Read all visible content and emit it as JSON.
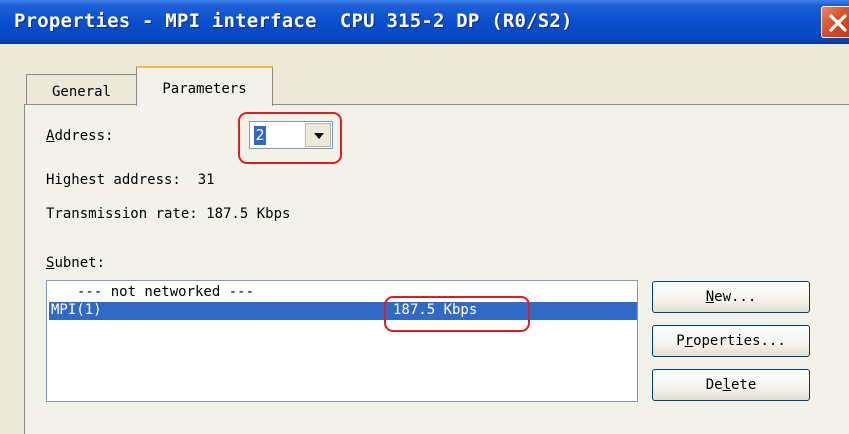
{
  "window": {
    "title": "Properties - MPI interface  CPU 315-2 DP (R0/S2)",
    "close_icon": "close-icon"
  },
  "tabs": [
    {
      "label": "General",
      "selected": false
    },
    {
      "label": "Parameters",
      "selected": true
    }
  ],
  "parameters": {
    "address_label_hotkey": "A",
    "address_label_rest": "ddress:",
    "address_value": "2",
    "highest_address": "Highest address:  31",
    "transmission_rate": "Transmission rate: 187.5 Kbps",
    "subnet_label_hotkey": "S",
    "subnet_label_rest": "ubnet:"
  },
  "subnet_list": [
    {
      "name": "--- not networked ---",
      "rate": "",
      "selected": false
    },
    {
      "name": "MPI(1)",
      "rate": "187.5 Kbps",
      "selected": true
    }
  ],
  "buttons": {
    "new_hotkey": "N",
    "new_rest": "ew...",
    "props_pre": "P",
    "props_hotkey": "r",
    "props_rest": "operties...",
    "delete_pre": "De",
    "delete_hotkey": "l",
    "delete_rest": "ete"
  },
  "colors": {
    "title_bar": "#0a4fd0",
    "selection": "#3169c6",
    "annotation": "#e11d1d"
  }
}
